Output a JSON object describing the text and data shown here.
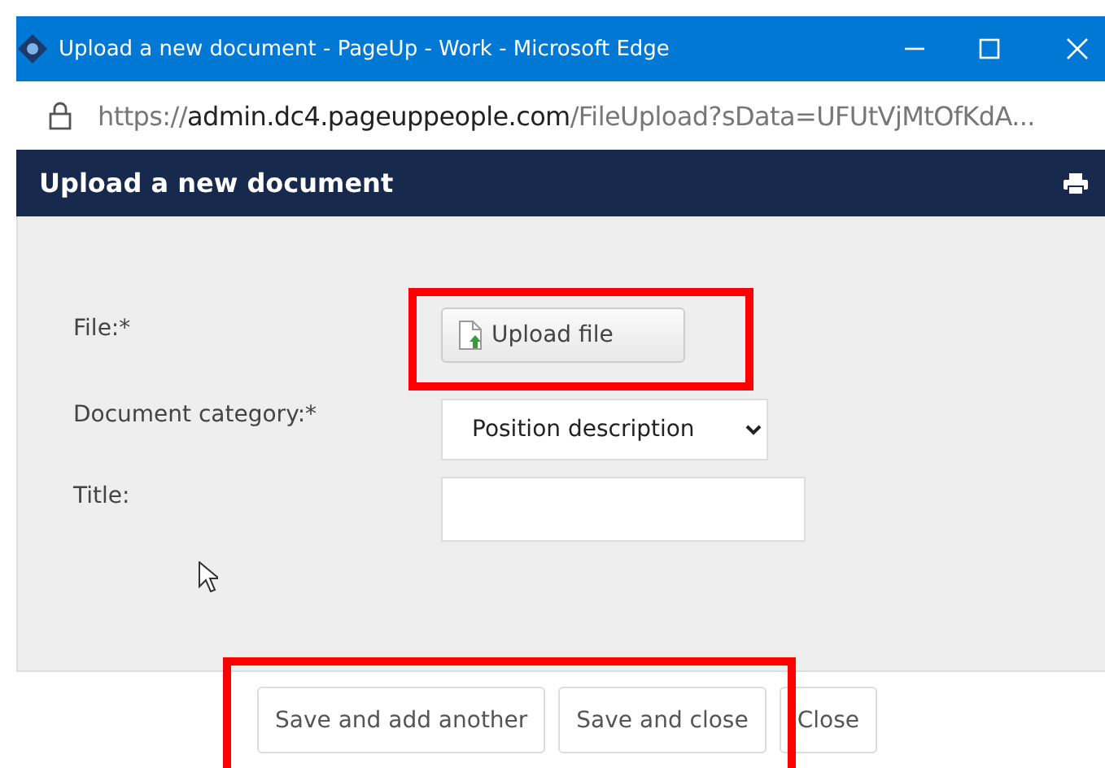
{
  "window": {
    "title": "Upload a new document - PageUp - Work - Microsoft Edge"
  },
  "address_bar": {
    "scheme": "https://",
    "host": "admin.dc4.pageuppeople.com",
    "path": "/FileUpload?sData=UFUtVjMtOfKdA..."
  },
  "header": {
    "title": "Upload a new document"
  },
  "form": {
    "fields": [
      {
        "kind": "file",
        "label": "File:*",
        "button": "Upload file"
      },
      {
        "kind": "select",
        "label": "Document category:*",
        "value": "Position description"
      },
      {
        "kind": "text",
        "label": "Title:"
      }
    ]
  },
  "buttons": [
    "Save and add another",
    "Save and close",
    "Close"
  ]
}
